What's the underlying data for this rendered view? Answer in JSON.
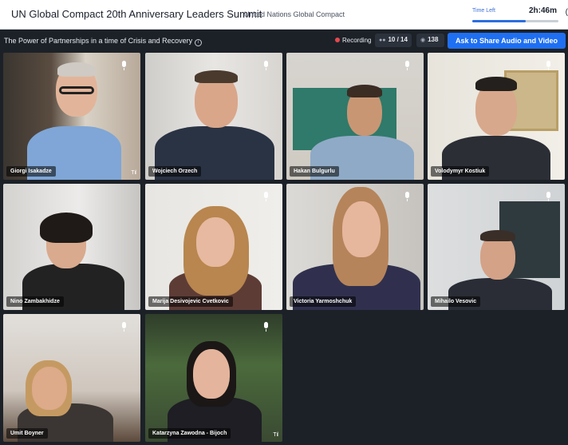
{
  "header": {
    "title": "UN Global Compact 20th Anniversary Leaders Summit",
    "organizer": "United Nations Global Compact",
    "time_left_label": "Time Left",
    "time_left_value": "2h:46m",
    "time_progress": 0.62,
    "edge_char": "("
  },
  "session": {
    "title": "The Power of Partnerships in a time of Crisis and Recovery",
    "info_icon": "i",
    "recording_label": "Recording",
    "participants": "10 / 14",
    "viewers": "138",
    "share_button": "Ask to Share Audio and Video"
  },
  "icons": {
    "participants": "person-group-icon",
    "viewers": "eye-icon",
    "mic": "microphone-icon",
    "signal": "signal-strength-icon"
  },
  "colors": {
    "accent": "#1f6ff2",
    "recording": "#e5484d",
    "background": "#1c2128"
  },
  "participants": [
    {
      "name": "Giorgi Isakadze"
    },
    {
      "name": "Wojciech Orzech"
    },
    {
      "name": "Hakan Bulgurlu"
    },
    {
      "name": "Volodymyr Kostiuk"
    },
    {
      "name": "Nino Zambakhidze"
    },
    {
      "name": "Marija Desivojevic Cvetkovic"
    },
    {
      "name": "Victoria Yarmoshchuk"
    },
    {
      "name": "Mihailo Vesovic"
    },
    {
      "name": "Umit Boyner"
    },
    {
      "name": "Katarzyna Zawodna - Bijoch"
    }
  ],
  "signal_glyph": "T ıl"
}
